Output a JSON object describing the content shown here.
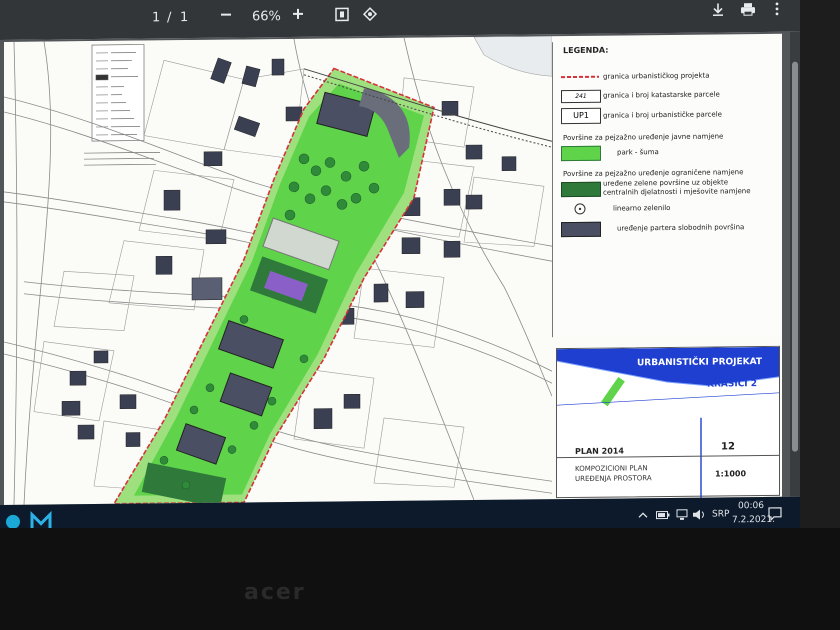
{
  "viewer": {
    "page_current": "1",
    "page_sep": "/",
    "page_total": "1",
    "zoom": "66%",
    "icons": {
      "zoom_out": "minus-icon",
      "zoom_in": "plus-icon",
      "fit": "fit-page-icon",
      "rotate": "rotate-icon",
      "download": "download-icon",
      "print": "print-icon",
      "more": "more-vert-icon"
    }
  },
  "legend": {
    "title": "LEGENDA:",
    "items": [
      {
        "label": "granica urbanističkog projekta",
        "symbol": "red-dashed-line"
      },
      {
        "label": "granica i broj katastarske parcele",
        "symbol_text": "241"
      },
      {
        "label": "granica i broj urbanističke parcele",
        "symbol_text": "UP1"
      },
      {
        "label": "Površine za pejzažno uređenje javne namjene",
        "symbol": "heading"
      },
      {
        "label": "park - šuma",
        "symbol": "green-fill"
      },
      {
        "label": "Površine za pejzažno uređenje ograničene namjene",
        "symbol": "heading"
      },
      {
        "label": "uređene zelene površine uz objekte",
        "symbol": "dark-green-fill"
      },
      {
        "label": "centralnih djelatnosti i mješovite namjene",
        "symbol": "continuation"
      },
      {
        "label": "linearno zelenilo",
        "symbol": "tree-circle"
      },
      {
        "label": "uređenje partera slobodnih površina",
        "symbol": "gray-fill"
      }
    ]
  },
  "title_block": {
    "project": "URBANISTIČKI PROJEKAT",
    "place": "KRAŠIĆI 2",
    "plan": "PLAN 2014",
    "sheet_no": "12",
    "drawing_line1": "KOMPOZICIONI PLAN",
    "drawing_line2": "UREĐENJA PROSTORA",
    "scale": "1:1000"
  },
  "taskbar": {
    "language": "SRP",
    "time": "00:06",
    "date": "7.2.2021.",
    "icons": [
      "chevron-up-icon",
      "battery-icon",
      "network-icon",
      "volume-icon",
      "notification-icon"
    ]
  },
  "monitor": {
    "brand": "acer"
  },
  "colors": {
    "toolbar": "#323639",
    "park_green": "#5fd34a",
    "dark_green": "#2f7a3a",
    "parter_gray": "#4a4f63",
    "boundary_red": "#d8313b",
    "sea_blue": "#1e3fd0"
  }
}
